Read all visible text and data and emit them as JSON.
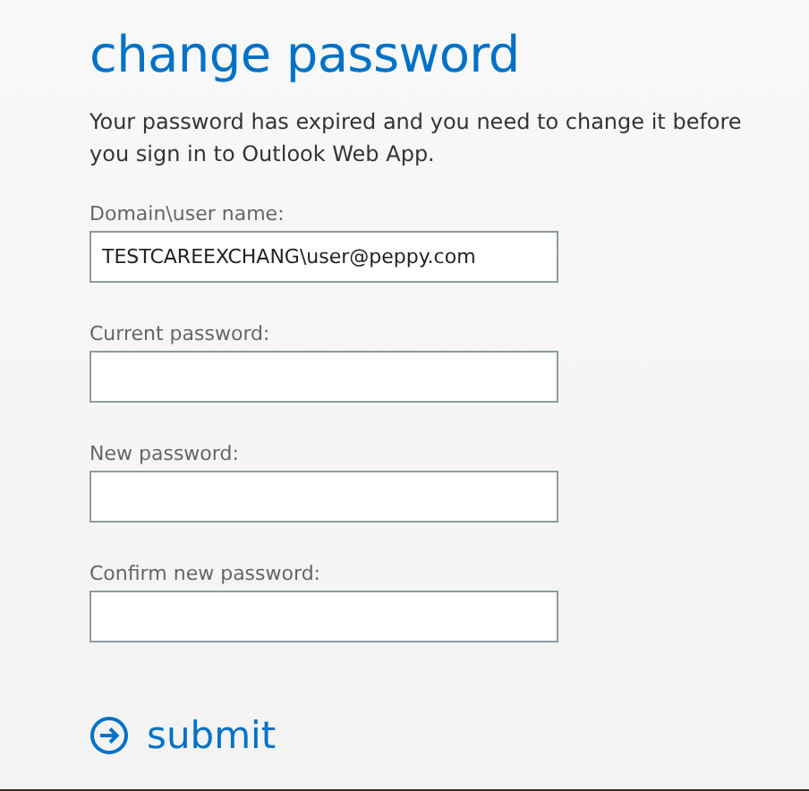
{
  "title": "change password",
  "message": "Your password has expired and you need to change it before you sign in to Outlook Web App.",
  "fields": [
    {
      "label": "Domain\\user name:",
      "value": "TESTCAREEXCHANG\\user@peppy.com"
    },
    {
      "label": "Current password:"
    },
    {
      "label": "New password:"
    },
    {
      "label": "Confirm new password:"
    }
  ],
  "submit": {
    "label": "submit"
  }
}
